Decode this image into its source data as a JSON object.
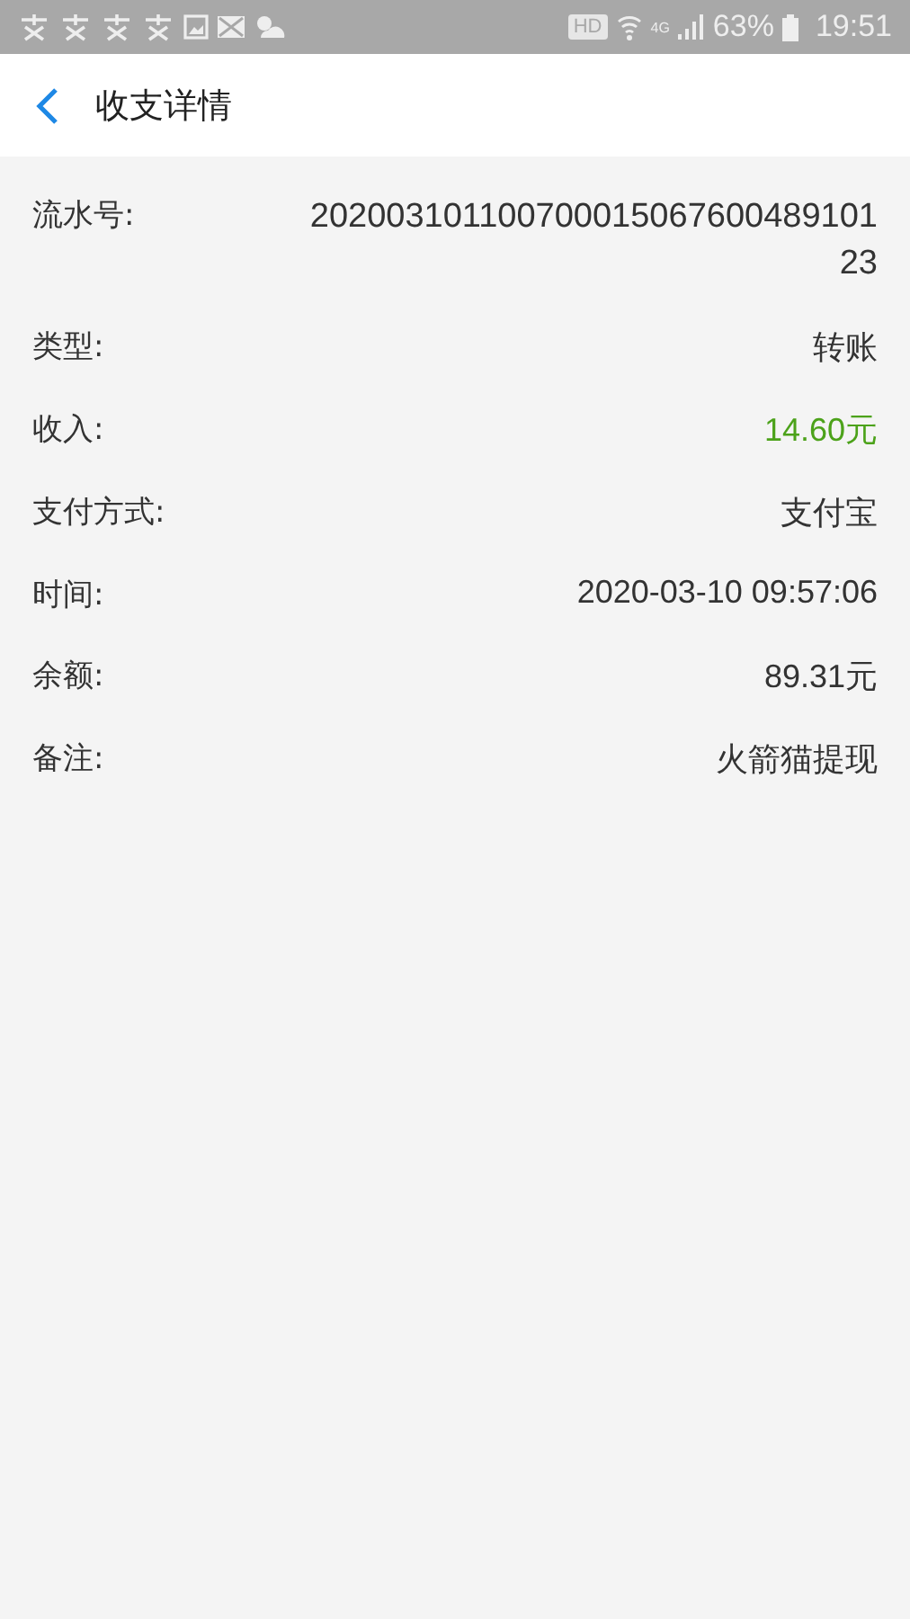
{
  "status_bar": {
    "hd": "HD",
    "network": "4G",
    "battery": "63%",
    "time": "19:51"
  },
  "header": {
    "title": "收支详情"
  },
  "details": [
    {
      "label": "流水号:",
      "value": "20200310110070001506760048910123",
      "kind": "serial",
      "color": "#333333"
    },
    {
      "label": "类型:",
      "value": "转账",
      "kind": "text",
      "color": "#333333"
    },
    {
      "label": "收入:",
      "value": "14.60元",
      "kind": "text",
      "color": "#4ca21a"
    },
    {
      "label": "支付方式:",
      "value": "支付宝",
      "kind": "text",
      "color": "#333333"
    },
    {
      "label": "时间:",
      "value": "2020-03-10 09:57:06",
      "kind": "text",
      "color": "#333333"
    },
    {
      "label": "余额:",
      "value": "89.31元",
      "kind": "text",
      "color": "#333333"
    },
    {
      "label": "备注:",
      "value": "火箭猫提现",
      "kind": "text",
      "color": "#333333"
    }
  ]
}
